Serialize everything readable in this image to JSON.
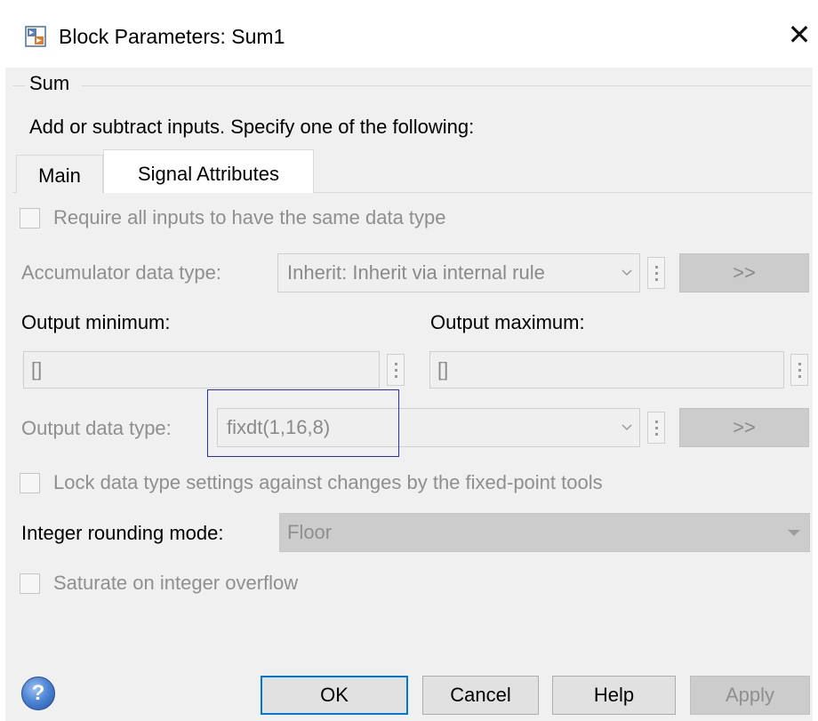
{
  "window": {
    "title": "Block Parameters: Sum1",
    "close_symbol": "✕"
  },
  "group": {
    "title": "Sum",
    "description": "Add or subtract inputs.  Specify one of the following:"
  },
  "tabs": [
    {
      "label": "Main",
      "active": false
    },
    {
      "label": "Signal Attributes",
      "active": true
    }
  ],
  "require_same_type": {
    "label": "Require all inputs to have the same data type",
    "checked": false,
    "enabled": false
  },
  "accumulator": {
    "label": "Accumulator data type:",
    "value": "Inherit: Inherit via internal rule",
    "assistant_label": ">>"
  },
  "output_minimum": {
    "label": "Output minimum:",
    "value": "[]"
  },
  "output_maximum": {
    "label": "Output maximum:",
    "value": "[]"
  },
  "output_data_type": {
    "label": "Output data type:",
    "value": "fixdt(1,16,8)",
    "assistant_label": ">>"
  },
  "lock_data_type": {
    "label": "Lock data type settings against changes by the fixed-point tools",
    "checked": false,
    "enabled": false
  },
  "integer_rounding": {
    "label": "Integer rounding mode:",
    "value": "Floor"
  },
  "saturate": {
    "label": "Saturate on integer overflow",
    "checked": false,
    "enabled": false
  },
  "footer": {
    "help_icon_symbol": "?",
    "ok_label": "OK",
    "cancel_label": "Cancel",
    "help_label": "Help",
    "apply_label": "Apply"
  },
  "colors": {
    "highlight_box": "#2b2bd9",
    "ok_border": "#0078d7",
    "disabled_text": "#8f8f8f"
  },
  "icons": [
    "simulink-block-icon",
    "close-icon",
    "chevron-down-icon",
    "vertical-dots-icon",
    "help-icon"
  ]
}
